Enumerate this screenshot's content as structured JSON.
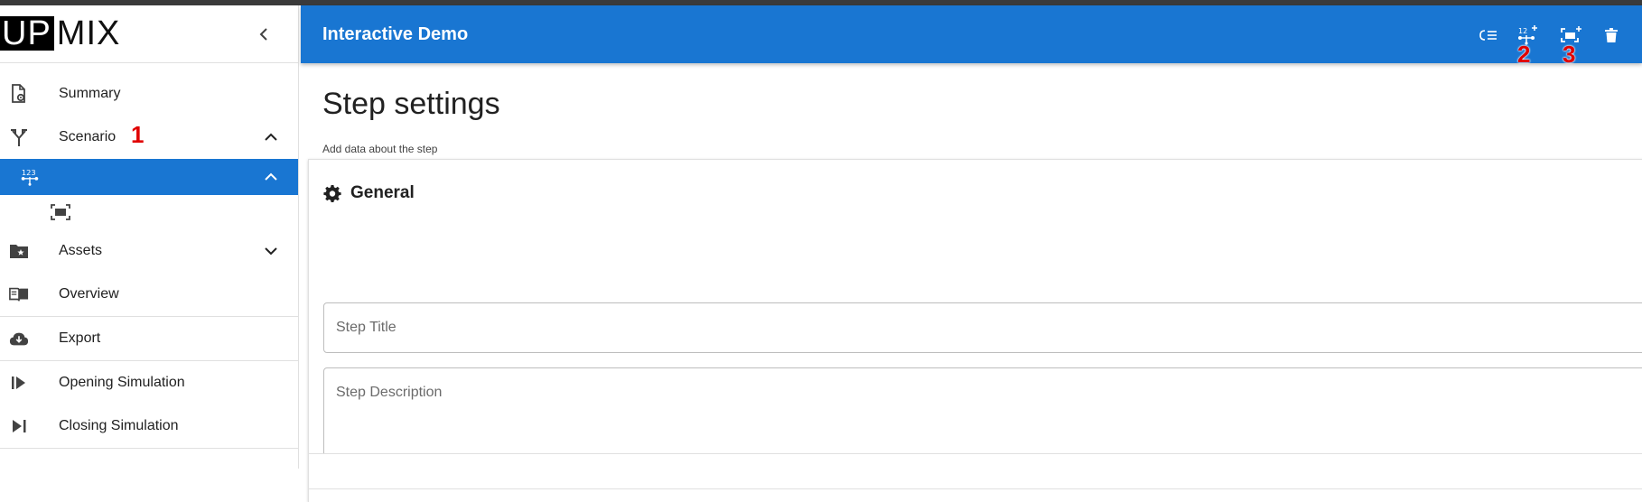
{
  "app": {
    "logo_up": "UP",
    "logo_mix": "MIX",
    "title": "Interactive Demo"
  },
  "sidebar": {
    "items": [
      {
        "label": "Summary",
        "icon": "document-gear-icon"
      },
      {
        "label": "Scenario",
        "icon": "fork-arrows-icon"
      },
      {
        "label": "",
        "icon": "numbered-steps-icon"
      },
      {
        "label": "",
        "icon": "screen-capture-icon"
      },
      {
        "label": "Assets",
        "icon": "folder-star-icon"
      },
      {
        "label": "Overview",
        "icon": "open-book-icon"
      },
      {
        "label": "Export",
        "icon": "cloud-download-icon"
      },
      {
        "label": "Opening Simulation",
        "icon": "play-start-icon"
      },
      {
        "label": "Closing Simulation",
        "icon": "skip-end-icon"
      }
    ]
  },
  "toolbar": {
    "buttons": [
      "list-check-icon",
      "add-step-icon",
      "add-screen-icon",
      "delete-icon"
    ]
  },
  "annotations": [
    "1",
    "2",
    "3"
  ],
  "main": {
    "heading": "Step settings",
    "subheading": "Add data about the step",
    "section_title": "General",
    "step_title_placeholder": "Step Title",
    "step_description_placeholder": "Step Description"
  },
  "colors": {
    "accent": "#1976d2",
    "annotation": "#e00000"
  }
}
